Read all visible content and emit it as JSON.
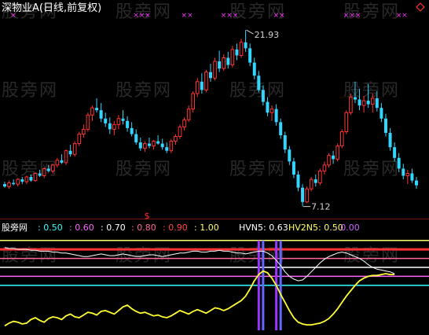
{
  "title": "深物业A(日线,前复权)",
  "watermark": "股旁网",
  "corner_icon": "diamond-outline-icon",
  "colors": {
    "up": "#ff3333",
    "down": "#33d6ff",
    "cross": "#ff33ff",
    "line_white": "#ffffff",
    "line_yellow": "#ffff33",
    "level_blue": "#3399ff"
  },
  "chart_data": [
    {
      "type": "candlestick",
      "title": "深物业A(日线,前复权)",
      "annotations": [
        {
          "text": "21.93",
          "kind": "high"
        },
        {
          "text": "7.12",
          "kind": "low"
        },
        {
          "text": "$",
          "kind": "marker"
        }
      ],
      "cross_marks": [
        "×",
        "×××",
        "××",
        "×××",
        "××",
        "×××",
        "××"
      ],
      "candles": [
        [
          9.0,
          9.2,
          8.7,
          8.8
        ],
        [
          8.8,
          9.3,
          8.6,
          9.1
        ],
        [
          9.1,
          9.4,
          8.9,
          9.0
        ],
        [
          9.0,
          9.5,
          8.8,
          9.4
        ],
        [
          9.4,
          9.6,
          9.0,
          9.2
        ],
        [
          9.2,
          9.7,
          9.0,
          9.6
        ],
        [
          9.6,
          9.8,
          9.2,
          9.3
        ],
        [
          9.3,
          10.0,
          9.2,
          9.9
        ],
        [
          9.9,
          10.2,
          9.6,
          9.7
        ],
        [
          9.7,
          10.4,
          9.5,
          10.3
        ],
        [
          10.3,
          10.6,
          10.0,
          10.1
        ],
        [
          10.1,
          10.7,
          9.9,
          10.6
        ],
        [
          10.6,
          11.2,
          10.4,
          11.0
        ],
        [
          11.0,
          11.5,
          10.7,
          10.8
        ],
        [
          10.8,
          11.9,
          10.6,
          11.8
        ],
        [
          11.8,
          12.3,
          11.3,
          11.5
        ],
        [
          11.5,
          12.6,
          11.3,
          12.4
        ],
        [
          12.4,
          13.4,
          12.2,
          13.2
        ],
        [
          13.2,
          14.0,
          12.9,
          13.6
        ],
        [
          13.6,
          15.0,
          13.4,
          14.8
        ],
        [
          14.8,
          15.6,
          14.3,
          15.4
        ],
        [
          15.4,
          16.2,
          15.0,
          15.2
        ],
        [
          15.2,
          15.8,
          14.2,
          14.5
        ],
        [
          14.5,
          15.0,
          13.8,
          14.1
        ],
        [
          14.1,
          14.6,
          13.2,
          13.6
        ],
        [
          13.6,
          14.3,
          13.1,
          14.0
        ],
        [
          14.0,
          14.8,
          13.6,
          14.5
        ],
        [
          14.5,
          15.2,
          14.0,
          14.3
        ],
        [
          14.3,
          14.7,
          13.4,
          13.7
        ],
        [
          13.7,
          14.2,
          13.0,
          13.2
        ],
        [
          13.2,
          13.6,
          12.3,
          12.5
        ],
        [
          12.5,
          12.9,
          11.8,
          12.0
        ],
        [
          12.0,
          12.6,
          11.7,
          12.4
        ],
        [
          12.4,
          12.9,
          12.0,
          12.2
        ],
        [
          12.2,
          12.7,
          11.9,
          12.6
        ],
        [
          12.6,
          13.1,
          12.3,
          12.4
        ],
        [
          12.4,
          12.8,
          11.9,
          12.1
        ],
        [
          12.1,
          12.5,
          11.6,
          11.8
        ],
        [
          11.8,
          12.8,
          11.6,
          12.6
        ],
        [
          12.6,
          13.2,
          12.3,
          13.0
        ],
        [
          13.0,
          14.0,
          12.8,
          13.8
        ],
        [
          13.8,
          14.6,
          13.5,
          14.4
        ],
        [
          14.4,
          15.6,
          14.2,
          15.3
        ],
        [
          15.3,
          16.8,
          15.0,
          16.6
        ],
        [
          16.6,
          17.9,
          16.3,
          17.6
        ],
        [
          17.6,
          18.3,
          16.6,
          16.9
        ],
        [
          16.9,
          18.6,
          16.7,
          18.4
        ],
        [
          18.4,
          19.1,
          17.6,
          17.9
        ],
        [
          17.9,
          19.6,
          17.7,
          19.3
        ],
        [
          19.3,
          20.2,
          18.4,
          18.7
        ],
        [
          18.7,
          19.9,
          18.5,
          19.6
        ],
        [
          19.6,
          20.1,
          18.7,
          19.0
        ],
        [
          19.0,
          20.6,
          18.8,
          20.3
        ],
        [
          20.3,
          20.8,
          19.4,
          19.8
        ],
        [
          19.8,
          21.2,
          19.6,
          20.9
        ],
        [
          20.9,
          21.93,
          20.1,
          20.4
        ],
        [
          20.4,
          20.8,
          18.9,
          19.2
        ],
        [
          19.2,
          19.6,
          17.8,
          18.1
        ],
        [
          18.1,
          18.5,
          16.7,
          16.9
        ],
        [
          16.9,
          17.3,
          15.6,
          15.9
        ],
        [
          15.9,
          16.3,
          14.7,
          15.0
        ],
        [
          15.0,
          15.6,
          14.3,
          15.3
        ],
        [
          15.3,
          15.7,
          13.9,
          14.2
        ],
        [
          14.2,
          14.5,
          12.8,
          13.1
        ],
        [
          13.1,
          13.4,
          11.6,
          11.9
        ],
        [
          11.9,
          12.2,
          10.6,
          10.9
        ],
        [
          10.9,
          11.2,
          9.5,
          9.8
        ],
        [
          9.8,
          10.1,
          8.4,
          8.7
        ],
        [
          8.7,
          9.0,
          7.12,
          7.5
        ],
        [
          7.5,
          8.8,
          7.4,
          8.6
        ],
        [
          8.6,
          9.6,
          8.4,
          9.4
        ],
        [
          9.4,
          9.8,
          8.8,
          9.1
        ],
        [
          9.1,
          10.3,
          8.9,
          10.1
        ],
        [
          10.1,
          10.9,
          9.8,
          10.6
        ],
        [
          10.6,
          11.6,
          10.4,
          11.4
        ],
        [
          11.4,
          11.8,
          10.7,
          11.1
        ],
        [
          11.1,
          12.4,
          10.9,
          12.2
        ],
        [
          12.2,
          13.6,
          12.0,
          13.4
        ],
        [
          13.4,
          15.2,
          13.2,
          15.0
        ],
        [
          15.0,
          16.6,
          14.8,
          16.3
        ],
        [
          16.3,
          17.6,
          15.8,
          16.1
        ],
        [
          16.1,
          17.0,
          15.2,
          15.6
        ],
        [
          15.6,
          16.4,
          15.0,
          16.0
        ],
        [
          16.0,
          17.4,
          15.4,
          15.7
        ],
        [
          15.7,
          16.6,
          15.0,
          16.2
        ],
        [
          16.2,
          16.8,
          15.1,
          15.4
        ],
        [
          15.4,
          15.8,
          14.2,
          14.5
        ],
        [
          14.5,
          14.9,
          13.0,
          13.3
        ],
        [
          13.3,
          13.7,
          11.8,
          12.1
        ],
        [
          12.1,
          12.5,
          10.9,
          11.2
        ],
        [
          11.2,
          11.6,
          10.0,
          10.3
        ],
        [
          10.3,
          10.7,
          9.4,
          9.7
        ],
        [
          9.7,
          10.2,
          9.0,
          9.9
        ],
        [
          9.9,
          10.3,
          9.1,
          9.3
        ],
        [
          9.3,
          9.6,
          8.6,
          8.9
        ]
      ]
    },
    {
      "type": "line",
      "legend": [
        {
          "text": "股旁网",
          "color": "#ffffff"
        },
        {
          "text": ": 0.50",
          "color": "#33ffff"
        },
        {
          "text": ": 0.60",
          "color": "#ff66ff"
        },
        {
          "text": ": 0.70",
          "color": "#ffffff"
        },
        {
          "text": ": 0.80",
          "color": "#ff6699"
        },
        {
          "text": ": 0.90",
          "color": "#ff4444"
        },
        {
          "text": ": 1.00",
          "color": "#ffff66"
        },
        {
          "text": "HVN5: 0.63",
          "color": "#ffffff"
        },
        {
          "text": "HV2N5: 0.50",
          "color": "#ffff66"
        },
        {
          "text": ": 0.00",
          "color": "#cc66ff"
        }
      ],
      "ylim": [
        0,
        1.05
      ],
      "levels": [
        {
          "value": 1.0,
          "color": "#ffff66"
        },
        {
          "value": 0.9,
          "color": "#ff3333"
        },
        {
          "value": 0.8,
          "color": "#ff6699"
        },
        {
          "value": 0.7,
          "color": "#ffffff"
        },
        {
          "value": 0.6,
          "color": "#ff66ff"
        },
        {
          "value": 0.5,
          "color": "#33ffff"
        }
      ],
      "series": [
        {
          "name": "HVN5",
          "color": "#ffffff",
          "values": [
            0.92,
            0.91,
            0.91,
            0.9,
            0.9,
            0.9,
            0.89,
            0.89,
            0.88,
            0.88,
            0.88,
            0.87,
            0.87,
            0.86,
            0.86,
            0.85,
            0.84,
            0.83,
            0.82,
            0.82,
            0.83,
            0.84,
            0.85,
            0.84,
            0.83,
            0.83,
            0.84,
            0.85,
            0.84,
            0.83,
            0.82,
            0.82,
            0.83,
            0.84,
            0.84,
            0.83,
            0.82,
            0.83,
            0.84,
            0.85,
            0.86,
            0.86,
            0.87,
            0.88,
            0.88,
            0.87,
            0.87,
            0.88,
            0.88,
            0.89,
            0.88,
            0.88,
            0.87,
            0.86,
            0.86,
            0.85,
            0.86,
            0.87,
            0.88,
            0.88,
            0.86,
            0.83,
            0.78,
            0.72,
            0.65,
            0.6,
            0.57,
            0.55,
            0.56,
            0.6,
            0.65,
            0.7,
            0.75,
            0.79,
            0.82,
            0.84,
            0.86,
            0.87,
            0.86,
            0.84,
            0.82,
            0.8,
            0.77,
            0.73,
            0.7,
            0.68,
            0.67,
            0.66,
            0.65,
            0.63
          ]
        },
        {
          "name": "HV2N5",
          "color": "#ffff33",
          "values": [
            0.05,
            0.08,
            0.1,
            0.09,
            0.07,
            0.08,
            0.12,
            0.14,
            0.11,
            0.09,
            0.13,
            0.15,
            0.14,
            0.12,
            0.16,
            0.18,
            0.15,
            0.14,
            0.17,
            0.2,
            0.19,
            0.17,
            0.21,
            0.22,
            0.2,
            0.18,
            0.22,
            0.26,
            0.28,
            0.24,
            0.21,
            0.19,
            0.2,
            0.18,
            0.16,
            0.17,
            0.15,
            0.14,
            0.16,
            0.19,
            0.22,
            0.2,
            0.18,
            0.21,
            0.23,
            0.21,
            0.19,
            0.22,
            0.25,
            0.24,
            0.22,
            0.24,
            0.27,
            0.3,
            0.33,
            0.38,
            0.46,
            0.55,
            0.62,
            0.66,
            0.64,
            0.58,
            0.5,
            0.4,
            0.31,
            0.22,
            0.14,
            0.09,
            0.07,
            0.06,
            0.06,
            0.07,
            0.08,
            0.1,
            0.13,
            0.18,
            0.24,
            0.31,
            0.38,
            0.44,
            0.5,
            0.55,
            0.58,
            0.6,
            0.61,
            0.61,
            0.62,
            0.63,
            0.62,
            0.62
          ]
        }
      ],
      "spikes": [
        {
          "at": 58,
          "color": "#9933ff",
          "value": 1.0
        },
        {
          "at": 59,
          "color": "#6666ff",
          "value": 1.0
        },
        {
          "at": 62,
          "color": "#9933ff",
          "value": 1.0
        },
        {
          "at": 63,
          "color": "#6666ff",
          "value": 1.0
        }
      ]
    }
  ]
}
